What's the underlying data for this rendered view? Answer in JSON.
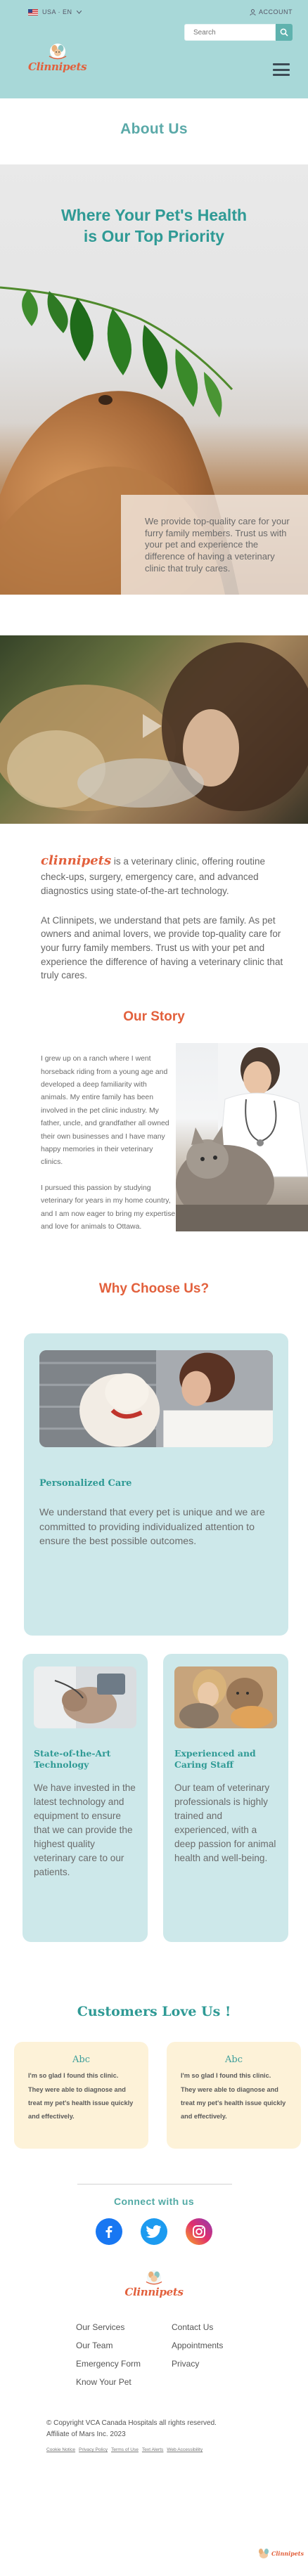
{
  "header": {
    "language": "USA · EN",
    "account_label": "ACCOUNT",
    "search_placeholder": "Search",
    "logo_text": "Clinnipets",
    "colors": {
      "bg": "#a8d8d8",
      "accent": "#5fb2ae",
      "brand": "#e2603c"
    }
  },
  "page": {
    "title": "About Us"
  },
  "hero": {
    "title_line1": "Where Your Pet's Health",
    "title_line2": "is Our Top Priority",
    "card_text": "We provide top-quality care for your furry family members. Trust us with your pet and experience the difference of having a veterinary clinic that truly cares."
  },
  "intro": {
    "brand": "clinnipets",
    "p1_rest": " is a veterinary clinic, offering routine check-ups, surgery, emergency care, and advanced diagnostics using state-of-the-art technology.",
    "p2": "At Clinnipets, we understand that pets are family. As pet owners and animal lovers, we provide top-quality care for your furry family members. Trust us with your pet and experience the difference of having a veterinary clinic that truly cares."
  },
  "story": {
    "title": "Our Story",
    "p1": "I grew up on a ranch where I went horseback riding from a young age and developed a deep familiarity with animals. My entire family has been involved in the pet clinic industry. My father, uncle, and grandfather all owned their own businesses and I have many happy memories in their veterinary clinics.",
    "p2": "I pursued this passion by studying veterinary for years in my home country, and I am now eager to bring my expertise and love for animals to Ottawa."
  },
  "why": {
    "title": "Why Choose Us?",
    "cards": [
      {
        "title": "Personalized Care",
        "body": "We understand that every pet is unique and we are committed to providing individualized attention to ensure the best possible outcomes."
      },
      {
        "title": "State-of-the-Art Technology",
        "body": "We have invested in the latest technology and equipment to ensure that we can provide the highest quality veterinary care to our patients."
      },
      {
        "title": "Experienced and Caring Staff",
        "body": "Our team of veterinary professionals is highly trained and experienced, with a deep passion for animal health and well-being."
      }
    ]
  },
  "testimonials": {
    "title": "Customers Love Us !",
    "items": [
      {
        "name": "Abc",
        "text": "I'm so glad I found this clinic. They were able to diagnose and treat my pet's health issue quickly and effectively."
      },
      {
        "name": "Abc",
        "text": "I'm so glad I found this clinic. They were able to diagnose and treat my pet's health issue quickly and effectively."
      }
    ]
  },
  "connect": {
    "title": "Connect with us"
  },
  "footer": {
    "logo_text": "Clinnipets",
    "col1": [
      "Our Services",
      "Our Team",
      "Emergency Form",
      "Know Your Pet"
    ],
    "col2": [
      "Contact Us",
      "Appointments",
      "Privacy"
    ],
    "copyright_line1": "© Copyright VCA Canada Hospitals all rights reserved.",
    "copyright_line2": "Affiliate of Mars Inc. 2023",
    "legal": [
      "Cookie Notice",
      "Privacy Policy",
      "Terms of Use",
      "Text Alerts",
      "Web Accessibility"
    ],
    "corner_logo": "Clinnipets"
  }
}
